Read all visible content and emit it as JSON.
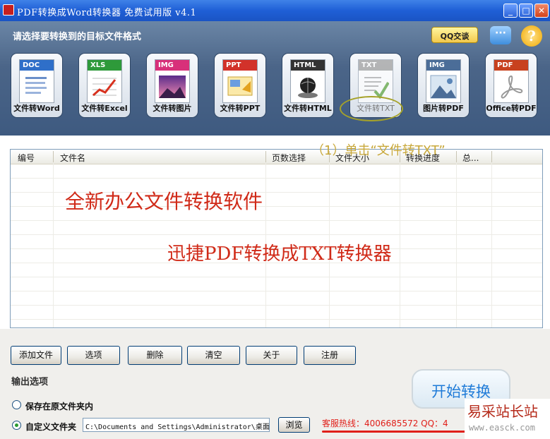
{
  "window": {
    "title": "PDF转换成Word转换器 免费试用版 v4.1",
    "minimize_icon": "minimize-icon",
    "maximize_icon": "maximize-icon",
    "close_icon": "close-icon"
  },
  "toolbar": {
    "prompt": "请选择要转换到的目标文件格式",
    "qq_label": "QQ交谈",
    "formats": [
      {
        "tag": "DOC",
        "label": "文件转Word",
        "color": "#2f6fc9"
      },
      {
        "tag": "XLS",
        "label": "文件转Excel",
        "color": "#2e9a3a"
      },
      {
        "tag": "IMG",
        "label": "文件转图片",
        "color": "#d8307a"
      },
      {
        "tag": "PPT",
        "label": "文件转PPT",
        "color": "#d2322a"
      },
      {
        "tag": "HTML",
        "label": "文件转HTML",
        "color": "#333333"
      },
      {
        "tag": "TXT",
        "label": "文件转TXT",
        "color": "#9a9a9a"
      },
      {
        "tag": "IMG",
        "label": "图片转PDF",
        "color": "#4b6d98"
      },
      {
        "tag": "PDF",
        "label": "Office转PDF",
        "color": "#c8411e"
      }
    ]
  },
  "annotation": {
    "step_note": "（1）单击“文件转TXT”"
  },
  "file_list": {
    "columns": [
      "编号",
      "文件名",
      "页数选择",
      "文件大小",
      "转换进度",
      "总..."
    ],
    "rows": []
  },
  "promo": {
    "line1": "全新办公文件转换软件",
    "line2": "迅捷PDF转换成TXT转换器"
  },
  "actions": {
    "add_file": "添加文件",
    "options": "选项",
    "delete": "删除",
    "clear": "清空",
    "about": "关于",
    "register": "注册"
  },
  "output": {
    "title": "输出选项",
    "option_same_folder": "保存在原文件夹内",
    "option_custom_folder": "自定义文件夹",
    "selected": "custom",
    "path": "C:\\Documents and Settings\\Administrator\\桌面",
    "browse": "浏览"
  },
  "start_button": "开始转换",
  "hotline": "客服热线：4006685572 QQ：4",
  "watermark": {
    "name": "易采站长站",
    "url": "www.easck.com"
  }
}
